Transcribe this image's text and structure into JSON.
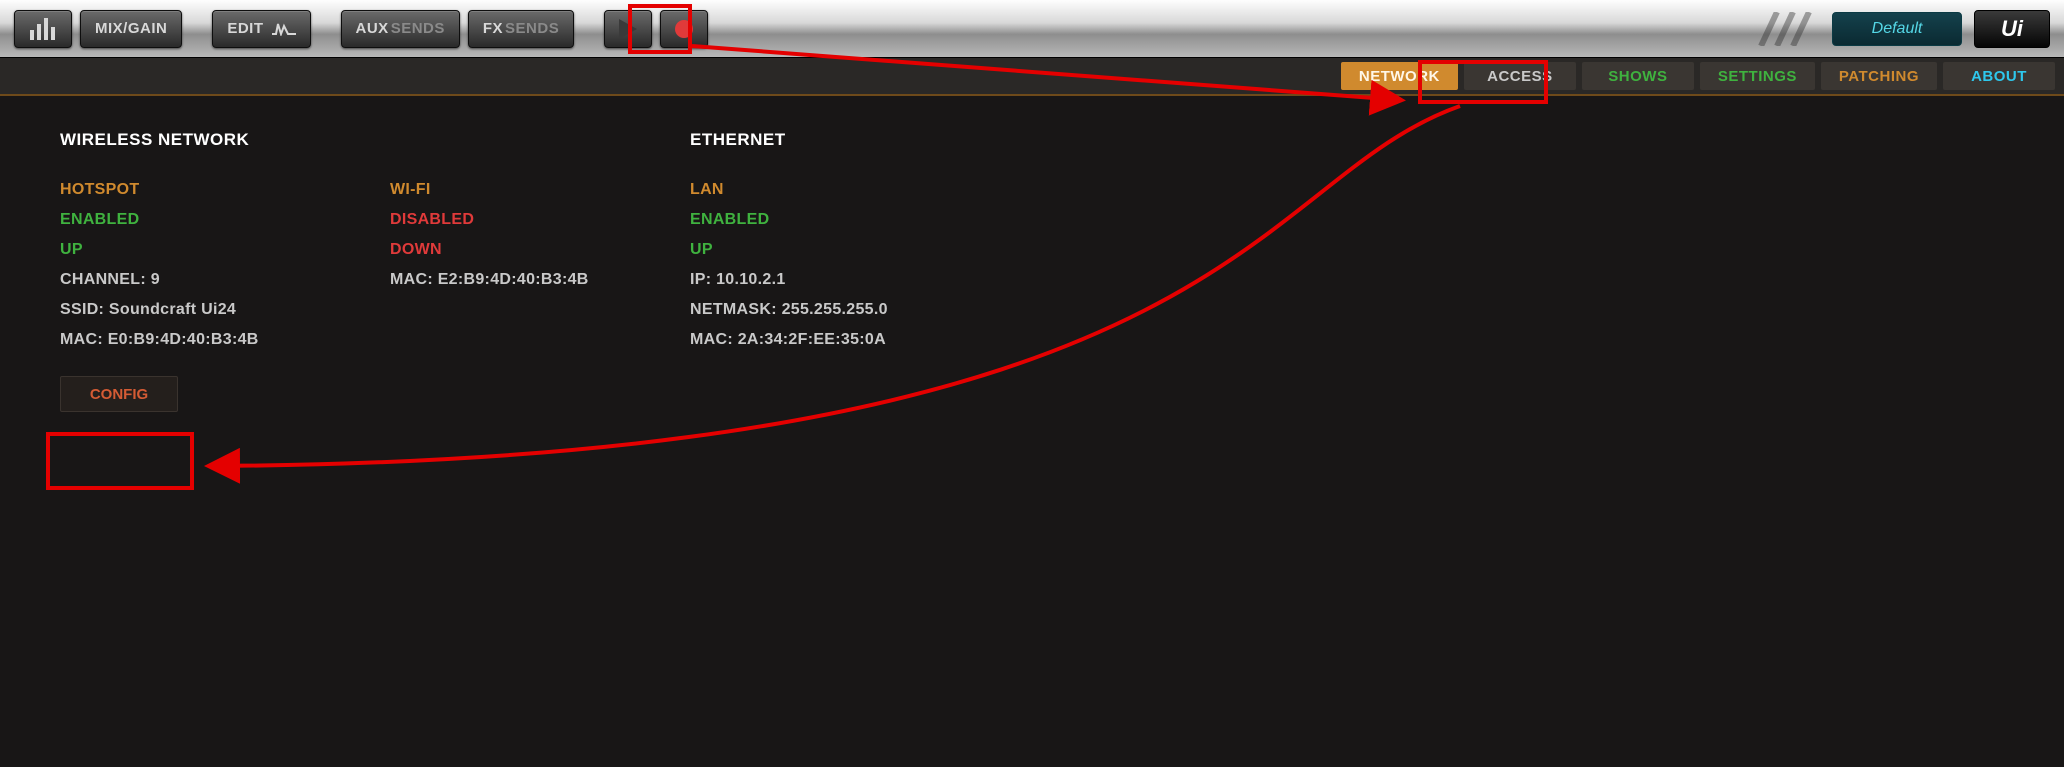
{
  "toolbar": {
    "meters_label": "",
    "mixgain_label": "MIX/GAIN",
    "edit_label": "EDIT",
    "aux_prefix": "AUX",
    "aux_suffix": "SENDS",
    "fx_prefix": "FX",
    "fx_suffix": "SENDS",
    "preset_label": "Default",
    "logo_label": "Ui"
  },
  "subtabs": {
    "network": "NETWORK",
    "access": "ACCESS",
    "shows": "SHOWS",
    "settings": "SETTINGS",
    "patching": "PATCHING",
    "about": "ABOUT"
  },
  "sections": {
    "wireless_title": "WIRELESS NETWORK",
    "ethernet_title": "ETHERNET"
  },
  "hotspot": {
    "name": "HOTSPOT",
    "status": "ENABLED",
    "link": "UP",
    "channel": "CHANNEL: 9",
    "ssid": "SSID: Soundcraft Ui24",
    "mac": "MAC: E0:B9:4D:40:B3:4B"
  },
  "wifi": {
    "name": "WI-FI",
    "status": "DISABLED",
    "link": "DOWN",
    "mac": "MAC: E2:B9:4D:40:B3:4B"
  },
  "lan": {
    "name": "LAN",
    "status": "ENABLED",
    "link": "UP",
    "ip": "IP: 10.10.2.1",
    "netmask": "NETMASK: 255.255.255.0",
    "mac": "MAC: 2A:34:2F:EE:35:0A"
  },
  "buttons": {
    "config": "CONFIG"
  }
}
